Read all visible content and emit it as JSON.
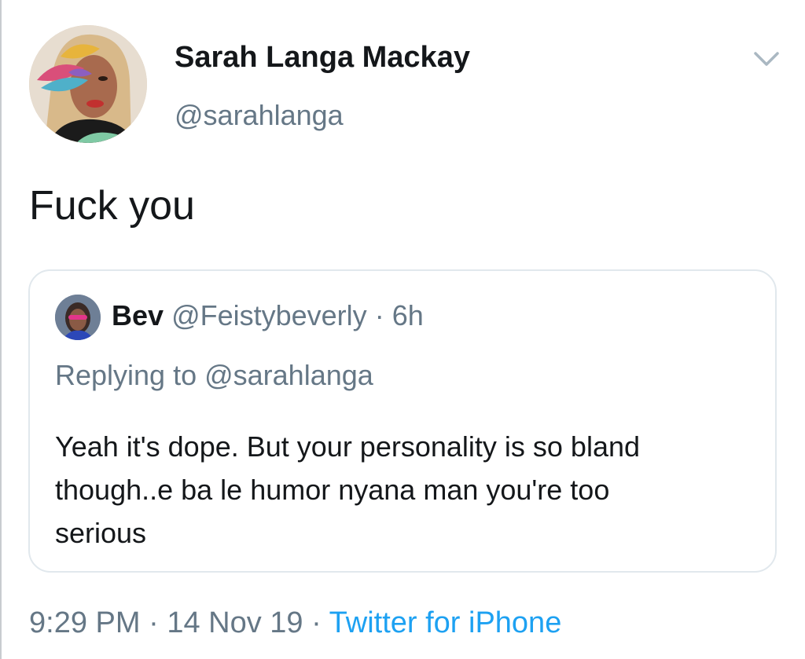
{
  "author": {
    "name": "Sarah Langa Mackay",
    "handle": "@sarahlanga"
  },
  "tweet": {
    "text": "Fuck you"
  },
  "quoted_tweet": {
    "name": "Bev",
    "handle": "@Feistybeverly",
    "separator": "·",
    "time": "6h",
    "replying_to": "Replying to @sarahlanga",
    "body_lines": [
      "Yeah it's dope.  But your personality is so bland",
      "though..e ba le humor nyana man you're too",
      "serious"
    ]
  },
  "footer": {
    "time": "9:29 PM",
    "separator": "·",
    "date": "14 Nov 19",
    "separator2": "·",
    "source": "Twitter for iPhone"
  },
  "icons": {
    "menu": "chevron-down-icon"
  },
  "colors": {
    "text_primary": "#14171a",
    "text_secondary": "#657786",
    "link": "#1da1f2",
    "border": "#e1e8ed"
  }
}
